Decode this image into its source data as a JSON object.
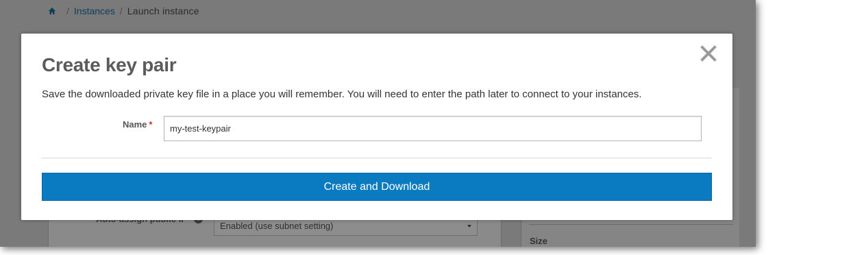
{
  "breadcrumb": {
    "home_icon": "home-icon",
    "separator": "/",
    "items": [
      {
        "label": "Instances"
      },
      {
        "label": "Launch instance"
      }
    ]
  },
  "background": {
    "auto_assign_label": "Auto-assign public IP",
    "info_icon": "i",
    "subnet_select_value": "Enabled (use subnet setting)",
    "size_label": "Size"
  },
  "modal": {
    "title": "Create key pair",
    "close_icon": "close-icon",
    "description": "Save the downloaded private key file in a place you will remember. You will need to enter the path later to connect to your instances.",
    "name_label": "Name",
    "required_marker": "*",
    "name_value": "my-test-keypair",
    "submit_label": "Create and Download"
  },
  "colors": {
    "accent": "#0a7bc0",
    "overlay": "#7a7a7a",
    "link": "#0f3e5c",
    "required": "#c9302c"
  }
}
